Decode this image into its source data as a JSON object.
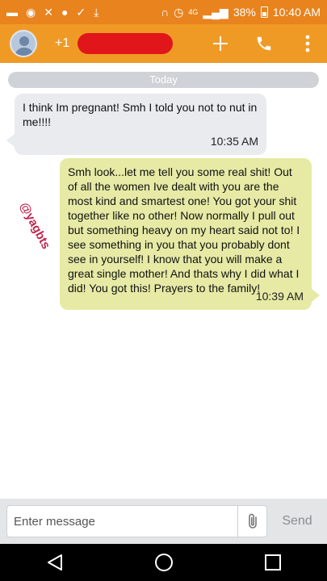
{
  "status_bar": {
    "battery": "38%",
    "time": "10:40 AM",
    "network": "4G"
  },
  "app_bar": {
    "contact_prefix": "+1",
    "icons": [
      "avatar",
      "add-icon",
      "phone-icon",
      "more-icon"
    ]
  },
  "thread": {
    "date_divider": "Today",
    "messages": [
      {
        "direction": "incoming",
        "text": "I think Im pregnant! Smh I told you not to nut in me!!!!",
        "time": "10:35 AM"
      },
      {
        "direction": "outgoing",
        "text": "Smh look...let me tell you some real shit! Out of all the women Ive dealt with you are the most kind and smartest one! You got your shit together like no other! Now normally I pull out but something heavy on my heart said not to! I see something in you that you probably dont see in yourself! I know that you will make a great single mother! And thats why I did what I did! You got this! Prayers to the family!",
        "time": "10:39 AM"
      }
    ],
    "watermark": "@yagbts"
  },
  "composer": {
    "placeholder": "Enter message",
    "send_label": "Send"
  },
  "colors": {
    "status_bar": "#e8831e",
    "app_bar": "#f09a26",
    "incoming_bubble": "#e9ebef",
    "outgoing_bubble": "#e6eaa5",
    "redaction": "#e0161a"
  }
}
